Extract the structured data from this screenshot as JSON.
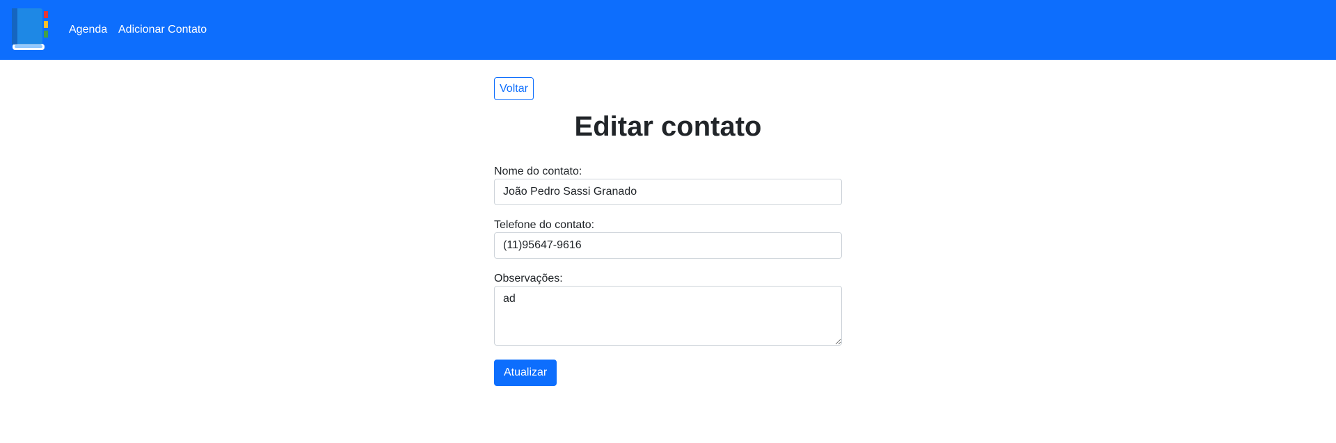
{
  "navbar": {
    "background": "#0d6efd",
    "logo_icon": "address-book-icon",
    "links": [
      {
        "label": "Agenda"
      },
      {
        "label": "Adicionar Contato"
      }
    ]
  },
  "main": {
    "back_button": "Voltar",
    "title": "Editar contato",
    "form": {
      "name_label": "Nome do contato:",
      "name_value": "João Pedro Sassi Granado",
      "phone_label": "Telefone do contato:",
      "phone_value": "(11)95647-9616",
      "notes_label": "Observações:",
      "notes_value": "ad",
      "submit_label": "Atualizar"
    }
  },
  "colors": {
    "primary": "#0d6efd",
    "text": "#212529",
    "border": "#ced4da"
  }
}
